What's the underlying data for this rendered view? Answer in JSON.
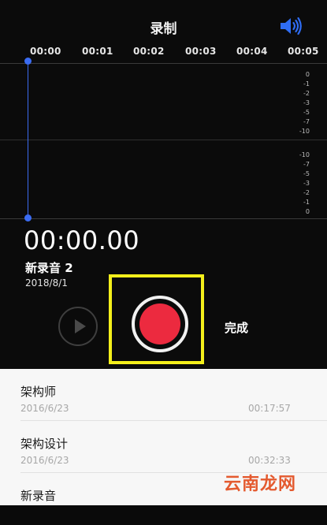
{
  "header": {
    "title": "录制",
    "speaker_icon": "speaker-volume-icon",
    "accent_color": "#3b6cf2"
  },
  "timeline": {
    "ticks": [
      "00:00",
      "00:01",
      "00:02",
      "00:03",
      "00:04",
      "00:05"
    ]
  },
  "waveform": {
    "db_upper": [
      "0",
      "-1",
      "-2",
      "-3",
      "-5",
      "-7",
      "-10"
    ],
    "db_lower": [
      "-10",
      "-7",
      "-5",
      "-3",
      "-2",
      "-1",
      "0"
    ]
  },
  "recording": {
    "elapsed": "00:00.00",
    "name": "新录音 2",
    "date": "2018/8/1"
  },
  "controls": {
    "play_icon": "play-icon",
    "record_icon": "record-icon",
    "record_color": "#ec2a3f",
    "highlight_color": "#f4ef1b",
    "done_label": "完成"
  },
  "list": {
    "items": [
      {
        "title": "架构师",
        "date": "2016/6/23",
        "duration": "00:17:57"
      },
      {
        "title": "架构设计",
        "date": "2016/6/23",
        "duration": "00:32:33"
      },
      {
        "title": "新录音",
        "date": "",
        "duration": ""
      }
    ]
  },
  "watermark": "云南龙网"
}
